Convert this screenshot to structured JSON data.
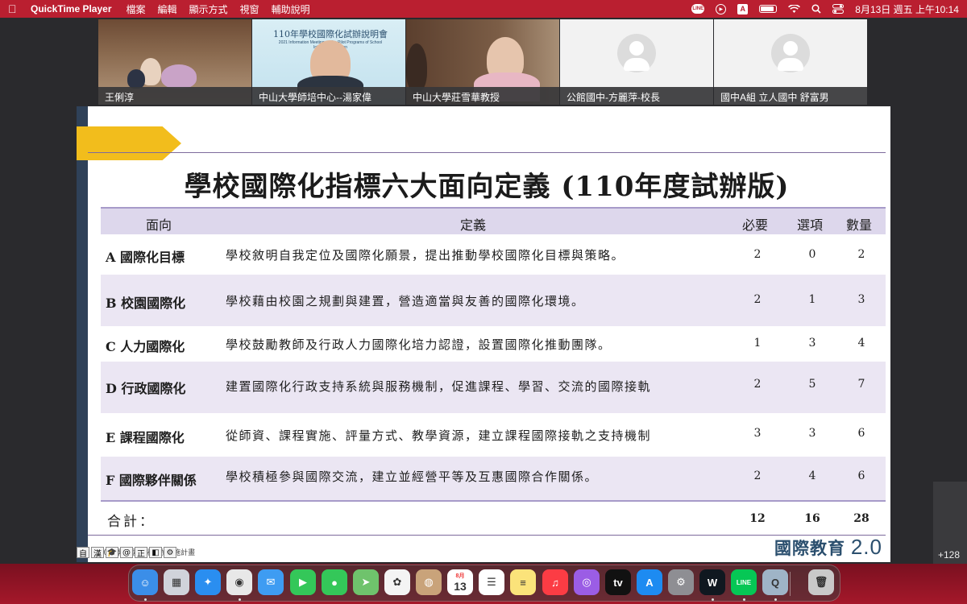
{
  "menubar": {
    "app_name": "QuickTime Player",
    "menus": [
      "檔案",
      "編輯",
      "顯示方式",
      "視窗",
      "輔助說明"
    ],
    "clock": "8月13日 週五 上午10:14",
    "status_icons": [
      "line-icon",
      "play-circle-icon",
      "input-a-icon",
      "battery-icon",
      "wifi-icon",
      "search-icon",
      "control-center-icon"
    ]
  },
  "participants": [
    {
      "name": "王俐淳"
    },
    {
      "name": "中山大學師培中心--湯家偉",
      "banner_title": "110年學校國際化試辦說明會",
      "banner_sub": "2021 Information Meeting on the Pilot Programs of School Internationalization"
    },
    {
      "name": "中山大學莊雪華教授"
    },
    {
      "name": "公館國中-方麗萍-校長"
    },
    {
      "name": "國中A組 立人國中 舒富男"
    }
  ],
  "slide": {
    "title": "學校國際化指標六大面向定義 (110年度試辦版)",
    "headers": {
      "aspect": "面向",
      "definition": "定義",
      "required": "必要",
      "optional": "選項",
      "count": "數量"
    },
    "rows": [
      {
        "name": "A 國際化目標",
        "definition": "學校敘明自我定位及國際化願景，提出推動學校國際化目標與策略。",
        "required": "2",
        "optional": "0",
        "count": "2"
      },
      {
        "name": "B 校園國際化",
        "definition": "學校藉由校園之規劃與建置，營造適當與友善的國際化環境。",
        "required": "2",
        "optional": "1",
        "count": "3"
      },
      {
        "name": "C 人力國際化",
        "definition": "學校鼓勵教師及行政人力國際化培力認證，設置國際化推動團隊。",
        "required": "1",
        "optional": "3",
        "count": "4"
      },
      {
        "name": "D 行政國際化",
        "definition": "建置國際化行政支持系統與服務機制，促進課程、學習、交流的國際接軌",
        "required": "2",
        "optional": "5",
        "count": "7"
      },
      {
        "name": "E 課程國際化",
        "definition": "從師資、課程實施、評量方式、教學資源，建立課程國際接軌之支持機制",
        "required": "3",
        "optional": "3",
        "count": "6"
      },
      {
        "name": "F 國際夥伴關係",
        "definition": "學校積極參與國際交流，建立並經營平等及互惠國際合作關係。",
        "required": "2",
        "optional": "4",
        "count": "6"
      }
    ],
    "total_label": "合計：",
    "totals": {
      "required": "12",
      "optional": "16",
      "count": "28"
    },
    "footer": "110年學校國際化試辦實施計畫",
    "logo_text": "國際教育",
    "logo_version": "2.0"
  },
  "ime_toolbar": [
    "自",
    "漢",
    "🎓",
    "@",
    "正",
    "◧",
    "⚙"
  ],
  "side_count": "+128",
  "dock": {
    "apps": [
      {
        "icon": "finder-icon",
        "color": "#3b8ee8",
        "glyph": "☺"
      },
      {
        "icon": "launchpad-icon",
        "color": "#d0d3da",
        "glyph": "▦"
      },
      {
        "icon": "safari-icon",
        "color": "#2a8ef0",
        "glyph": "✦"
      },
      {
        "icon": "chrome-icon",
        "color": "#e8e8e8",
        "glyph": "◉"
      },
      {
        "icon": "mail-icon",
        "color": "#3e9cf2",
        "glyph": "✉"
      },
      {
        "icon": "facetime-icon",
        "color": "#34c759",
        "glyph": "▶"
      },
      {
        "icon": "messages-icon",
        "color": "#34c759",
        "glyph": "●"
      },
      {
        "icon": "maps-icon",
        "color": "#6fc36c",
        "glyph": "➤"
      },
      {
        "icon": "photos-icon",
        "color": "#f4f4f4",
        "glyph": "✿"
      },
      {
        "icon": "contacts-icon",
        "color": "#c9a37a",
        "glyph": "◍"
      },
      {
        "icon": "calendar-icon",
        "color": "#ffffff",
        "glyph": "13",
        "sub": "8月"
      },
      {
        "icon": "reminders-icon",
        "color": "#ffffff",
        "glyph": "☰"
      },
      {
        "icon": "notes-icon",
        "color": "#fbe37a",
        "glyph": "≡"
      },
      {
        "icon": "music-icon",
        "color": "#fc3c44",
        "glyph": "♫"
      },
      {
        "icon": "podcasts-icon",
        "color": "#9b5de5",
        "glyph": "◎"
      },
      {
        "icon": "apple-tv-icon",
        "color": "#111111",
        "glyph": "tv"
      },
      {
        "icon": "app-store-icon",
        "color": "#1d8bf1",
        "glyph": "A"
      },
      {
        "icon": "system-preferences-icon",
        "color": "#8e8e93",
        "glyph": "⚙"
      },
      {
        "icon": "webex-icon",
        "color": "#101820",
        "glyph": "W"
      },
      {
        "icon": "line-app-icon",
        "color": "#06c755",
        "glyph": "LINE"
      },
      {
        "icon": "quicktime-icon",
        "color": "#9fb4c7",
        "glyph": "Q"
      },
      {
        "icon": "trash-icon",
        "color": "#c9c9c9",
        "glyph": "🗑"
      }
    ]
  }
}
